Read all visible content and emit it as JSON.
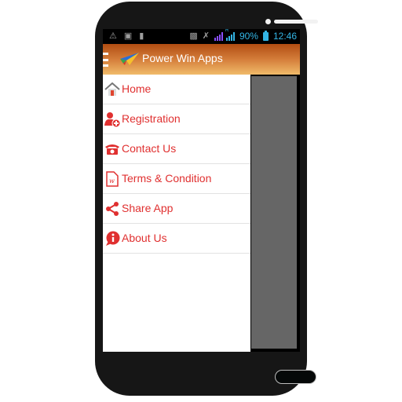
{
  "status_bar": {
    "left_icons": [
      "warning-icon",
      "image-icon",
      "sd-card-icon"
    ],
    "right_icons": [
      "bluetooth-icon",
      "mute-icon",
      "signal-icon",
      "roaming-signal-icon",
      "battery-icon"
    ],
    "roaming_indicator": "R",
    "battery_percent": "90%",
    "time": "12:46"
  },
  "app_bar": {
    "title": "Power Win Apps",
    "colors": {
      "gradient_top": "#b14d12",
      "gradient_bottom": "#f0bb6a"
    }
  },
  "drawer": {
    "items": [
      {
        "label": "Home",
        "icon": "home-icon"
      },
      {
        "label": "Registration",
        "icon": "add-user-icon"
      },
      {
        "label": "Contact Us",
        "icon": "telephone-icon"
      },
      {
        "label": "Terms & Condition",
        "icon": "document-icon"
      },
      {
        "label": "Share App",
        "icon": "share-icon"
      },
      {
        "label": "About Us",
        "icon": "info-icon"
      }
    ],
    "accent_color": "#e03030"
  }
}
